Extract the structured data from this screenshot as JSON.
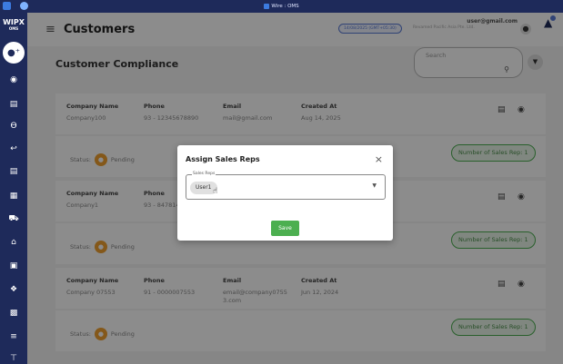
{
  "window": {
    "title": "Wire : OMS"
  },
  "sidebar": {
    "logo_main": "WIPX",
    "logo_sub": "OMS",
    "items": [
      "customers-icon",
      "box-icon",
      "truck-icon",
      "cart-icon",
      "return-icon",
      "clipboard-icon",
      "grid-icon",
      "delivery-icon",
      "warehouse-icon",
      "report-icon",
      "support-icon",
      "chart-icon",
      "list-icon",
      "upload-icon"
    ]
  },
  "header": {
    "title": "Customers",
    "date_pill": "14/08/2025 (GMT+05:30)",
    "timezone": "Revamed Pacific Asia Pte. Ltd.",
    "user_email": "user@gmail.com"
  },
  "page": {
    "section_title": "Customer Compliance",
    "search_label": "Search"
  },
  "columns": {
    "company": "Company Name",
    "phone": "Phone",
    "email": "Email",
    "created": "Created At"
  },
  "customers": [
    {
      "company": "Company100",
      "phone": "93 - 12345678890",
      "email": "mail@gmail.com",
      "created": "Aug 14, 2025",
      "status_label": "Status:",
      "status": "Pending",
      "reps": "Number of Sales Rep: 1"
    },
    {
      "company": "Company1",
      "phone": "93 - 847814",
      "email": "",
      "created": "",
      "status_label": "Status:",
      "status": "Pending",
      "reps": "Number of Sales Rep: 1"
    },
    {
      "company": "Company 07553",
      "phone": "91 - 0000007553",
      "email": "email@company0755 3.com",
      "created": "Jun 12, 2024",
      "status_label": "Status:",
      "status": "Pending",
      "reps": "Number of Sales Rep: 1"
    }
  ],
  "modal": {
    "title": "Assign Sales Reps",
    "field_label": "Sales Reps",
    "chip": "User1",
    "save": "Save",
    "close": "×"
  },
  "colors": {
    "sidebar": "#1e2a5a",
    "accent": "#5a7bd6",
    "success": "#4caf50",
    "pending": "#f0a030"
  }
}
